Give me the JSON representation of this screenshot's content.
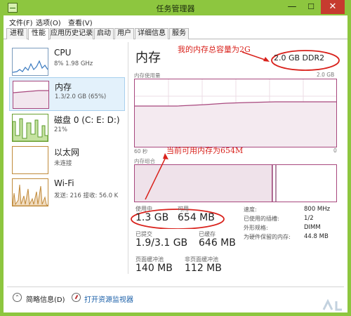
{
  "window": {
    "title": "任务管理器",
    "accent": "#8dc63f",
    "close_symbol": "✕",
    "minimize_symbol": "—",
    "maximize_symbol": "☐"
  },
  "menu": [
    "文件(F)",
    "选项(O)",
    "查看(V)"
  ],
  "tabs": [
    {
      "label": "进程",
      "active": false
    },
    {
      "label": "性能",
      "active": true
    },
    {
      "label": "应用历史记录",
      "active": false
    },
    {
      "label": "启动",
      "active": false
    },
    {
      "label": "用户",
      "active": false
    },
    {
      "label": "详细信息",
      "active": false
    },
    {
      "label": "服务",
      "active": false
    }
  ],
  "sidebar": [
    {
      "title": "CPU",
      "sub": "8% 1.98 GHz",
      "icon": "cpu-graph-icon"
    },
    {
      "title": "内存",
      "sub": "1.3/2.0 GB (65%)",
      "icon": "memory-graph-icon"
    },
    {
      "title": "磁盘 0 (C: E: D:)",
      "sub": "21%",
      "icon": "disk-graph-icon"
    },
    {
      "title": "以太网",
      "sub": "未连接",
      "icon": "ethernet-graph-icon"
    },
    {
      "title": "Wi-Fi",
      "sub": "发送: 216 接收: 56.0 K",
      "icon": "wifi-graph-icon"
    }
  ],
  "main": {
    "title": "内存",
    "capacity": "2.0 GB DDR2",
    "usage_label": "内存使用量",
    "usage_max": "2.0 GB",
    "time_label": "60 秒",
    "time_end": "0",
    "composition_label": "内存组合",
    "annotation_capacity": "我的内存总容量为2G",
    "annotation_available": "当前可用内存为654M"
  },
  "stats": {
    "in_use_label": "使用中",
    "in_use": "1.3 GB",
    "available_label": "可用",
    "available": "654 MB",
    "committed_label": "已提交",
    "committed": "1.9/3.1 GB",
    "cached_label": "已缓存",
    "cached": "646 MB",
    "paged_label": "页面缓冲池",
    "paged": "140 MB",
    "nonpaged_label": "非页面缓冲池",
    "nonpaged": "112 MB"
  },
  "specs": {
    "speed_label": "速度:",
    "speed": "800 MHz",
    "slots_label": "已使用的插槽:",
    "slots": "1/2",
    "form_label": "外形规格:",
    "form": "DIMM",
    "reserved_label": "为硬件保留的内存:",
    "reserved": "44.8 MB"
  },
  "footer": {
    "summary": "简略信息(D)",
    "resmon": "打开资源监视器"
  }
}
